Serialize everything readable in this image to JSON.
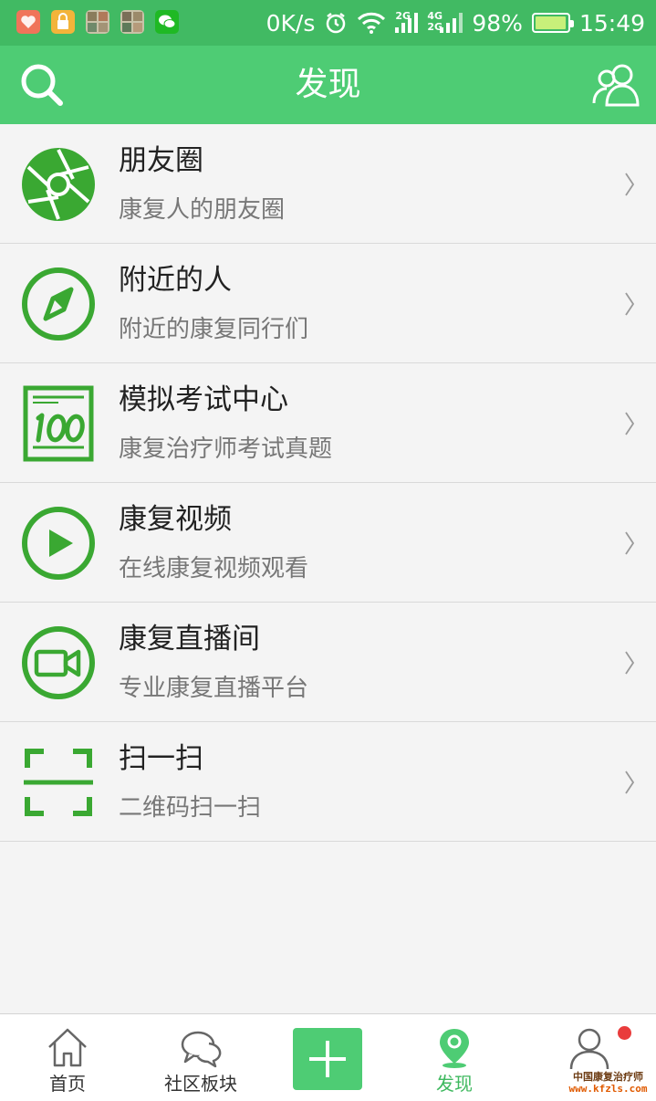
{
  "status_bar": {
    "speed": "0K/s",
    "net_tag_1": "2G",
    "net_tag_2a": "4G",
    "net_tag_2b": "2G",
    "battery": "98%",
    "battery_level": 0.98,
    "time": "15:49",
    "icons": [
      "heart-app-icon",
      "lock-app-icon",
      "gallery-app-icon",
      "gallery-app-icon",
      "wechat-icon",
      "alarm-icon",
      "wifi-icon",
      "signal-icon",
      "signal-icon",
      "battery-icon"
    ]
  },
  "header": {
    "title": "发现",
    "left_icon": "search-icon",
    "right_icon": "friends-icon"
  },
  "list": [
    {
      "title": "朋友圈",
      "subtitle": "康复人的朋友圈",
      "icon": "aperture-icon"
    },
    {
      "title": "附近的人",
      "subtitle": "附近的康复同行们",
      "icon": "compass-icon"
    },
    {
      "title": "模拟考试中心",
      "subtitle": "康复治疗师考试真题",
      "icon": "exam-100-icon"
    },
    {
      "title": "康复视频",
      "subtitle": "在线康复视频观看",
      "icon": "play-icon"
    },
    {
      "title": "康复直播间",
      "subtitle": "专业康复直播平台",
      "icon": "video-camera-icon"
    },
    {
      "title": "扫一扫",
      "subtitle": "二维码扫一扫",
      "icon": "scan-icon"
    }
  ],
  "bottom_nav": {
    "items": [
      {
        "label": "首页",
        "icon": "home-icon"
      },
      {
        "label": "社区板块",
        "icon": "chat-bubbles-icon"
      },
      {
        "label": "",
        "icon": "plus-icon"
      },
      {
        "label": "发现",
        "icon": "location-pin-icon",
        "active": true
      },
      {
        "label": "",
        "icon": "user-icon",
        "badge": true
      }
    ]
  },
  "watermark": {
    "text": "中国康复治疗师",
    "url": "www.kfzls.com"
  },
  "colors": {
    "status_bar": "#41ba63",
    "header": "#4ecc74",
    "icon_green": "#3aa832",
    "active_label": "#3fb95f",
    "badge": "#e93c3c"
  }
}
